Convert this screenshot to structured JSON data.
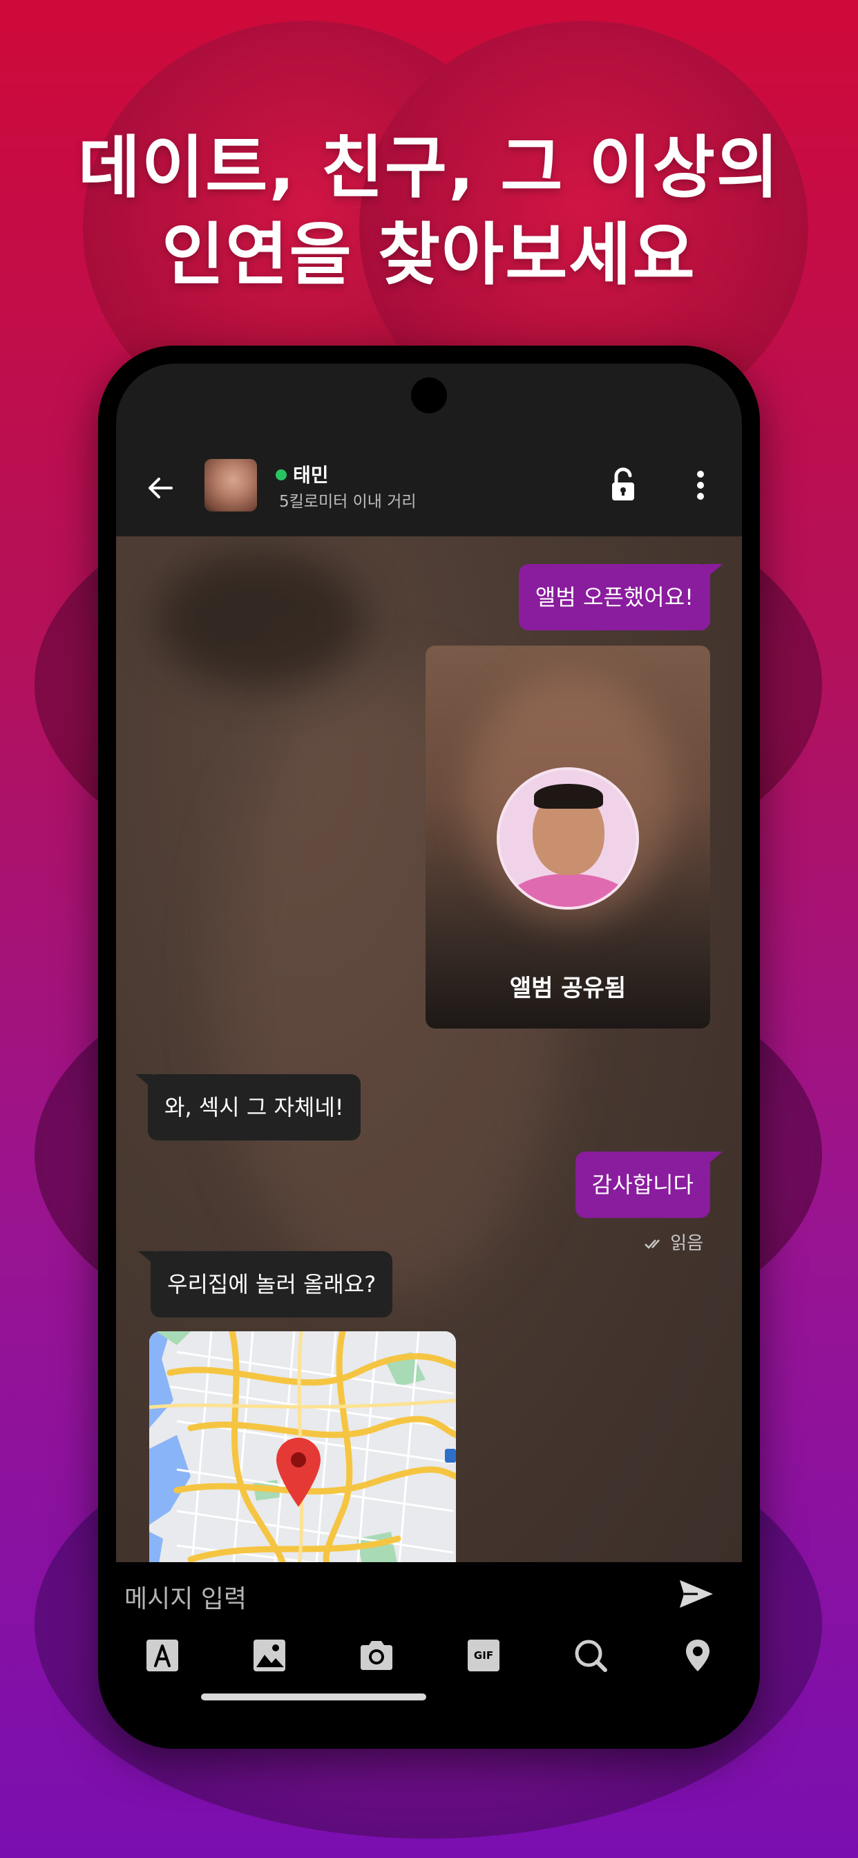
{
  "headline": {
    "line1": "데이트, 친구, 그 이상의",
    "line2": "인연을 찾아보세요"
  },
  "chat_header": {
    "back_icon": "arrow-left-icon",
    "contact_name": "태민",
    "distance": "5킬로미터 이내 거리",
    "status_color": "#29c462",
    "lock_icon": "unlock-icon",
    "more_icon": "more-vertical-icon"
  },
  "messages": {
    "msg1": "앨범 오픈했어요!",
    "album_label": "앨범 공유됨",
    "msg2": "와, 섹시 그 자체네!",
    "msg3": "감사합니다",
    "read_status": "읽음",
    "msg4": "우리집에 놀러 올래요?"
  },
  "input": {
    "placeholder": "메시지 입력",
    "send_icon": "send-icon"
  },
  "toolbar": {
    "items": [
      "text-icon",
      "image-icon",
      "camera-icon",
      "gif-icon",
      "search-icon",
      "location-pin-icon"
    ],
    "gif_label": "GIF"
  },
  "colors": {
    "outgoing_bubble": "#8a1c9e",
    "incoming_bubble": "#222222",
    "background_top": "#cf0a3a",
    "background_bottom": "#7a0fb0"
  }
}
